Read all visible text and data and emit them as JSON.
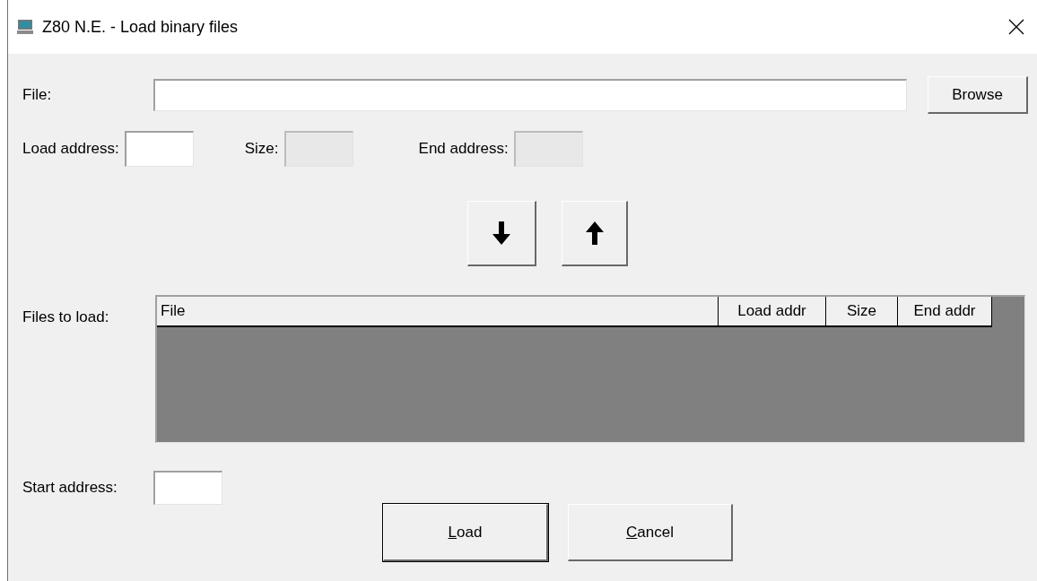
{
  "window": {
    "title": "Z80 N.E. - Load binary files"
  },
  "file": {
    "label": "File:"
  },
  "browse_button": {
    "label": "Browse"
  },
  "address_fields": [
    {
      "label": "Load address:",
      "disabled": false
    },
    {
      "label": "Size:",
      "disabled": true
    },
    {
      "label": "End address:",
      "disabled": true
    }
  ],
  "files_list": {
    "label": "Files to load:",
    "columns": [
      "File",
      "Load addr",
      "Size",
      "End addr"
    ]
  },
  "start_address": {
    "label": "Start address:"
  },
  "buttons": [
    {
      "label": "Load",
      "mnemonic": true,
      "default": true
    },
    {
      "label": "Cancel",
      "mnemonic": true,
      "default": false
    }
  ]
}
